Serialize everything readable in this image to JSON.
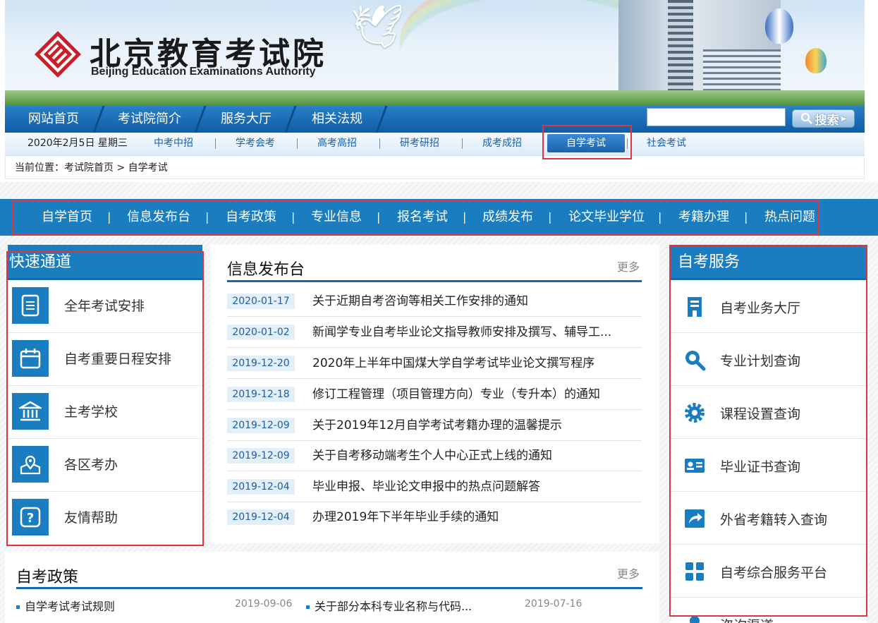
{
  "header": {
    "logo_cn": "北京教育考试院",
    "logo_en": "Beijing Education Examinations Authority"
  },
  "main_nav": [
    "网站首页",
    "考试院简介",
    "服务大厅",
    "相关法规"
  ],
  "search": {
    "placeholder": "",
    "button_label": "搜索"
  },
  "sub_nav": {
    "date": "2020年2月5日  星期三",
    "links": [
      "中考中招",
      "学考会考",
      "高考高招",
      "研考研招",
      "成考成招",
      "自学考试",
      "社会考试"
    ],
    "active": "自学考试"
  },
  "breadcrumb": {
    "prefix": "当前位置：",
    "home": "考试院首页",
    "separator": ">",
    "current": "自学考试"
  },
  "section_nav": [
    "自学首页",
    "信息发布台",
    "自考政策",
    "专业信息",
    "报名考试",
    "成绩发布",
    "论文毕业学位",
    "考籍办理",
    "热点问题"
  ],
  "quick_channel": {
    "title": "快速通道",
    "items": [
      {
        "label": "全年考试安排",
        "icon": "document-icon"
      },
      {
        "label": "自考重要日程安排",
        "icon": "calendar-icon"
      },
      {
        "label": "主考学校",
        "icon": "school-building-icon"
      },
      {
        "label": "各区考办",
        "icon": "map-pin-icon"
      },
      {
        "label": "友情帮助",
        "icon": "help-icon"
      }
    ]
  },
  "info_board": {
    "title": "信息发布台",
    "more": "更多",
    "items": [
      {
        "date": "2020-01-17",
        "title": "关于近期自考咨询等相关工作安排的通知"
      },
      {
        "date": "2020-01-02",
        "title": "新闻学专业自考毕业论文指导教师安排及撰写、辅导工..."
      },
      {
        "date": "2019-12-20",
        "title": "2020年上半年中国煤大学自学考试毕业论文撰写程序"
      },
      {
        "date": "2019-12-18",
        "title": "修订工程管理（项目管理方向）专业（专升本）的通知"
      },
      {
        "date": "2019-12-09",
        "title": "关于2019年12月自学考试考籍办理的温馨提示"
      },
      {
        "date": "2019-12-09",
        "title": "关于自考移动端考生个人中心正式上线的通知"
      },
      {
        "date": "2019-12-04",
        "title": "毕业申报、毕业论文申报中的热点问题解答"
      },
      {
        "date": "2019-12-04",
        "title": "办理2019年下半年毕业手续的通知"
      }
    ]
  },
  "self_service": {
    "title": "自考服务",
    "items": [
      {
        "label": "自考业务大厅",
        "icon": "building-icon"
      },
      {
        "label": "专业计划查询",
        "icon": "magnifier-icon"
      },
      {
        "label": "课程设置查询",
        "icon": "gear-icon"
      },
      {
        "label": "毕业证书查询",
        "icon": "id-card-icon"
      },
      {
        "label": "外省考籍转入查询",
        "icon": "share-arrow-icon"
      },
      {
        "label": "自考综合服务平台",
        "icon": "grid-icon"
      },
      {
        "label": "咨询渠道",
        "icon": "user-icon"
      }
    ]
  },
  "policy": {
    "title": "自考政策",
    "more": "更多",
    "items": [
      {
        "title": "自学考试考试规则",
        "date": "2019-09-06"
      },
      {
        "title": "关于部分本科专业名称与代码...",
        "date": "2019-07-16"
      }
    ]
  },
  "colors": {
    "brand_blue": "#1a7dbf",
    "highlight_red": "#e2343d",
    "date_bg": "#e2eef8"
  }
}
